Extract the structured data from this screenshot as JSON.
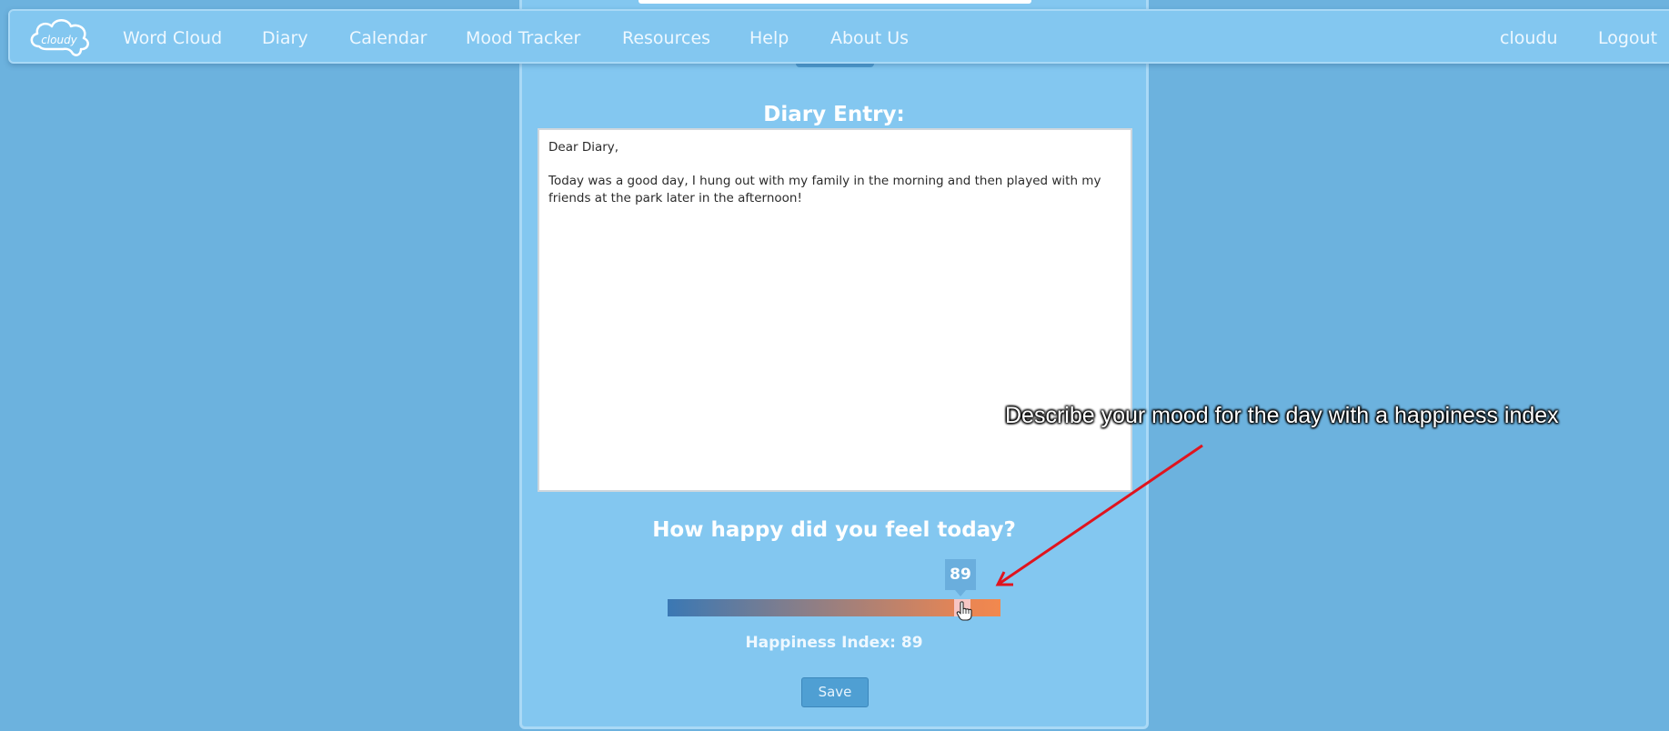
{
  "navbar": {
    "logo_text": "cloudy",
    "links": [
      "Word Cloud",
      "Diary",
      "Calendar",
      "Mood Tracker",
      "Resources",
      "Help",
      "About Us"
    ],
    "username": "cloudu",
    "logout_label": "Logout"
  },
  "diary": {
    "heading": "Diary Entry:",
    "entry_text": "Dear Diary,\n\nToday was a good day, I hung out with my family in the morning and then played with my friends at the park later in the afternoon!"
  },
  "mood": {
    "question": "How happy did you feel today?",
    "slider_value": "89",
    "slider_min": 0,
    "slider_max": 100,
    "slider_fraction": 0.89,
    "index_text": "Happiness Index: 89",
    "gradient_start_color": "#3a78b4",
    "gradient_end_color": "#f2884e"
  },
  "save_label": "Save",
  "annotation": {
    "text": "Describe your mood for the day with a happiness index",
    "arrow_color": "#e0141e"
  },
  "colors": {
    "background": "#6cb2de",
    "card": "#83c7f0",
    "button": "#4f9fd3"
  }
}
